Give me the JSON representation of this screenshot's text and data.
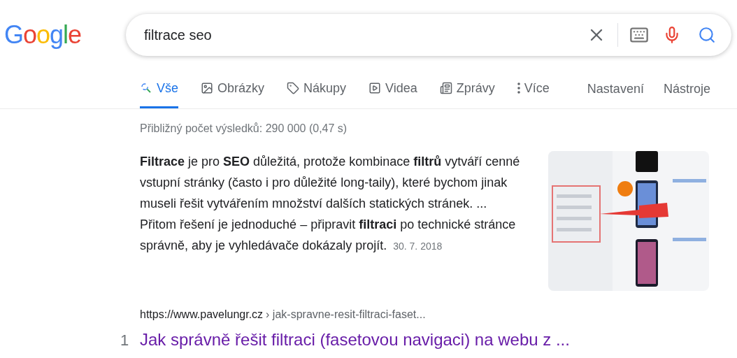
{
  "logo": "Google",
  "search": {
    "value": "filtrace seo"
  },
  "tabs": [
    {
      "kind": "all",
      "label": "Vše",
      "selected": true
    },
    {
      "kind": "images",
      "label": "Obrázky",
      "selected": false
    },
    {
      "kind": "shopping",
      "label": "Nákupy",
      "selected": false
    },
    {
      "kind": "videos",
      "label": "Videa",
      "selected": false
    },
    {
      "kind": "news",
      "label": "Zprávy",
      "selected": false
    },
    {
      "kind": "more",
      "label": "Více",
      "selected": false
    }
  ],
  "tools": [
    "Nastavení",
    "Nástroje"
  ],
  "result_stats": "Přibližný počet výsledků: 290 000 (0,47 s)",
  "snippet": {
    "text": "**Filtrace** je pro **SEO** důležitá, protože kombinace **filtrů** vytváří cenné vstupní stránky (často i pro důležité long-taily), které bychom jinak museli řešit vytvářením množství dalších statických stránek. ... Přitom řešení je jednoduché – připravit **filtraci** po technické stránce správně, aby je vyhledávače dokázaly projít.",
    "date": "30. 7. 2018"
  },
  "result": {
    "url": "https://www.pavelungr.cz",
    "path": "› jak-spravne-resit-filtraci-faset...",
    "index": "1",
    "title": "Jak správně řešit filtraci (fasetovou navigaci) na webu z ..."
  }
}
